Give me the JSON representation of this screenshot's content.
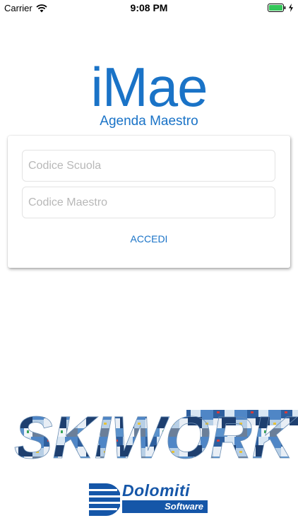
{
  "status_bar": {
    "carrier": "Carrier",
    "time": "9:08 PM",
    "icons": [
      "wifi-icon",
      "battery-icon",
      "charging-icon"
    ],
    "battery_color": "#34c759"
  },
  "app": {
    "title": "iMae",
    "subtitle": "Agenda Maestro",
    "accent_color": "#1a73c7"
  },
  "login": {
    "school_code_placeholder": "Codice Scuola",
    "school_code_value": "",
    "teacher_code_placeholder": "Codice Maestro",
    "teacher_code_value": "",
    "submit_label": "ACCEDI"
  },
  "footer": {
    "banner_text": "SKIWORK",
    "company_name": "Dolomiti",
    "company_tagline": "Software",
    "company_color": "#1556a8"
  }
}
